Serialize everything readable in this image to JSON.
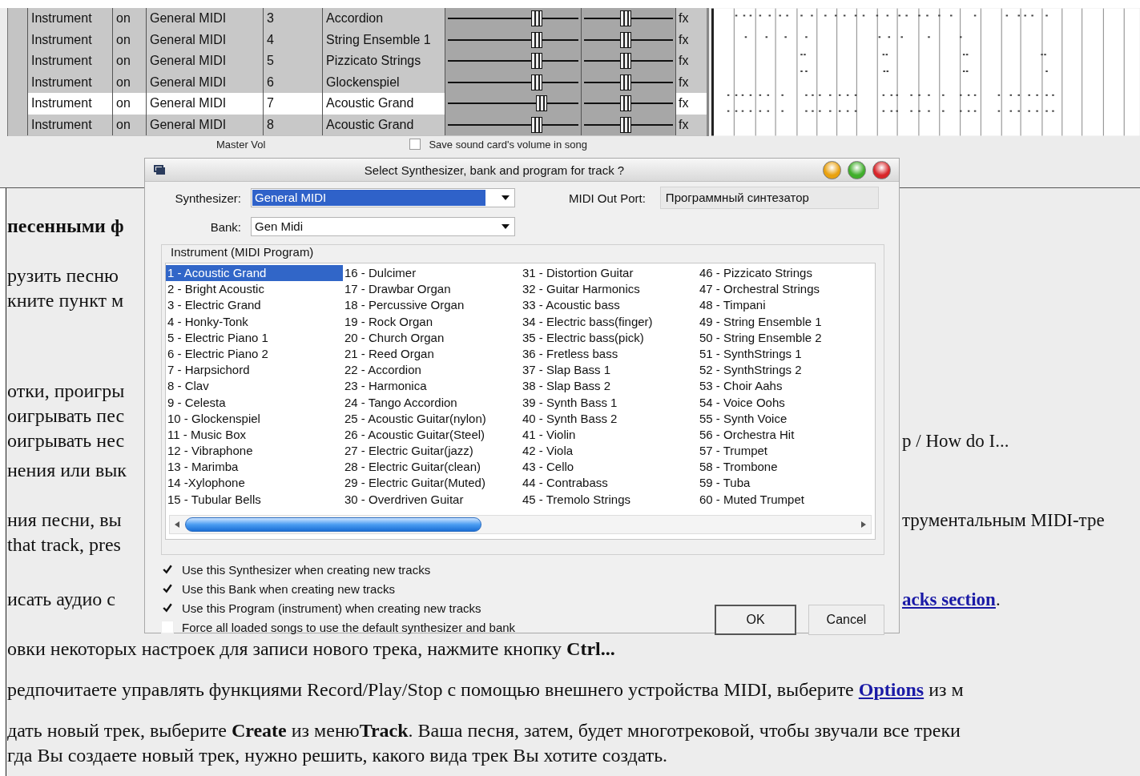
{
  "tracks": {
    "rows": [
      {
        "type": "Instrument",
        "state": "on",
        "synth": "General MIDI",
        "channel": "3",
        "program": "Accordion",
        "volume": {
          "level": 0.68
        },
        "pan": {
          "level": 0.47
        },
        "fx": "fx",
        "selected": false
      },
      {
        "type": "Instrument",
        "state": "on",
        "synth": "General MIDI",
        "channel": "4",
        "program": "String Ensemble 1",
        "volume": {
          "level": 0.68
        },
        "pan": {
          "level": 0.47
        },
        "fx": "fx",
        "selected": false
      },
      {
        "type": "Instrument",
        "state": "on",
        "synth": "General MIDI",
        "channel": "5",
        "program": "Pizzicato Strings",
        "volume": {
          "level": 0.68
        },
        "pan": {
          "level": 0.47
        },
        "fx": "fx",
        "selected": false
      },
      {
        "type": "Instrument",
        "state": "on",
        "synth": "General MIDI",
        "channel": "6",
        "program": "Glockenspiel",
        "volume": {
          "level": 0.68
        },
        "pan": {
          "level": 0.47
        },
        "fx": "fx",
        "selected": false
      },
      {
        "type": "Instrument",
        "state": "on",
        "synth": "General MIDI",
        "channel": "7",
        "program": "Acoustic Grand",
        "volume": {
          "level": 0.72
        },
        "pan": {
          "level": 0.47
        },
        "fx": "fx",
        "selected": true
      },
      {
        "type": "Instrument",
        "state": "on",
        "synth": "General MIDI",
        "channel": "8",
        "program": "Acoustic Grand",
        "volume": {
          "level": 0.68
        },
        "pan": {
          "level": 0.47
        },
        "fx": "fx",
        "selected": false
      }
    ]
  },
  "mixer": {
    "master_vol": "Master Vol",
    "save_volume": {
      "label": "Save sound card's volume in song",
      "checked": false
    }
  },
  "article": {
    "paragraphs": [
      {
        "lines": [
          {
            "kind": "split",
            "left": [
              {
                "kind": "text",
                "text": "**песенными ф**"
              }
            ]
          }
        ]
      },
      {
        "lines": [
          {
            "kind": "split",
            "left": [
              {
                "kind": "text",
                "text": "рузить песню"
              }
            ]
          },
          {
            "kind": "split",
            "left": [
              {
                "kind": "text",
                "text": "кните пункт м"
              }
            ]
          }
        ]
      },
      {
        "lines": [
          {
            "kind": "split",
            "left": [
              {
                "kind": "text",
                "text": "отки, проигры"
              }
            ]
          },
          {
            "kind": "split",
            "left": [
              {
                "kind": "text",
                "text": "оигрывать пес"
              }
            ]
          },
          {
            "kind": "split",
            "left": [
              {
                "kind": "text",
                "text": "оигрывать нес"
              }
            ],
            "right": [
              {
                "kind": "text",
                "text": "p / How do I..."
              }
            ]
          }
        ]
      },
      {
        "lines": [
          {
            "kind": "split",
            "left": [
              {
                "kind": "text",
                "text": "нения или вык"
              }
            ]
          }
        ]
      },
      {
        "lines": [
          {
            "kind": "split",
            "left": [
              {
                "kind": "text",
                "text": "ния песни, вы"
              }
            ],
            "right": [
              {
                "kind": "text",
                "text": "трументальным MIDI-тре"
              }
            ]
          },
          {
            "kind": "split",
            "left": [
              {
                "kind": "text",
                "text": "that track, pres"
              }
            ]
          }
        ]
      },
      {
        "lines": [
          {
            "kind": "split",
            "left": [
              {
                "kind": "text",
                "text": "исать аудио с"
              }
            ],
            "right": [
              {
                "kind": "link",
                "text": "acks section"
              },
              {
                "kind": "text",
                "text": "."
              }
            ]
          }
        ]
      },
      {
        "lines": [
          {
            "kind": "full",
            "left": [
              {
                "kind": "text",
                "text": "овки некоторых настроек для записи нового трека, нажмите кнопку **Ctrl...**"
              }
            ]
          }
        ]
      },
      {
        "lines": [
          {
            "kind": "full",
            "left": [
              {
                "kind": "text",
                "text": "редпочитаете управлять функциями Record/Play/Stop с помощью внешнего устройства MIDI, выберите"
              },
              {
                "kind": "link",
                "text": "Options"
              },
              {
                "kind": "text",
                "text": "из м"
              }
            ]
          }
        ]
      },
      {
        "lines": [
          {
            "kind": "full",
            "left": [
              {
                "kind": "text",
                "text": "дать новый трек, выберите **Create** из меню**Track**. Ваша песня, затем, будет многотрековой, чтобы звучали все треки"
              }
            ]
          },
          {
            "kind": "full",
            "left": [
              {
                "kind": "text",
                "text": "гда Вы создаете новый трек, нужно решить, какого вида трек Вы хотите создать."
              }
            ]
          }
        ]
      }
    ]
  },
  "dialog": {
    "title": "Select Synthesizer, bank and program for track ?",
    "synthesizer": {
      "label": "Synthesizer:",
      "value": "General MIDI"
    },
    "midi_out_port": {
      "label": "MIDI Out Port:",
      "value": "Программный синтезатор"
    },
    "bank": {
      "label": "Bank:",
      "value": "Gen Midi"
    },
    "instrument_group": {
      "title": "Instrument (MIDI Program)",
      "items": [
        {
          "label": "1 - Acoustic Grand",
          "selected": true
        },
        {
          "label": "2 - Bright Acoustic",
          "selected": false
        },
        {
          "label": "3 - Electric Grand",
          "selected": false
        },
        {
          "label": "4 - Honky-Tonk",
          "selected": false
        },
        {
          "label": "5 - Electric Piano 1",
          "selected": false
        },
        {
          "label": "6 - Electric Piano 2",
          "selected": false
        },
        {
          "label": "7 - Harpsichord",
          "selected": false
        },
        {
          "label": "8 - Clav",
          "selected": false
        },
        {
          "label": "9 - Celesta",
          "selected": false
        },
        {
          "label": "10 - Glockenspiel",
          "selected": false
        },
        {
          "label": "11 - Music Box",
          "selected": false
        },
        {
          "label": "12 - Vibraphone",
          "selected": false
        },
        {
          "label": "13 - Marimba",
          "selected": false
        },
        {
          "label": "14 -Xylophone",
          "selected": false
        },
        {
          "label": "15 - Tubular Bells",
          "selected": false
        },
        {
          "label": "16 - Dulcimer",
          "selected": false
        },
        {
          "label": "17 - Drawbar Organ",
          "selected": false
        },
        {
          "label": "18 - Percussive Organ",
          "selected": false
        },
        {
          "label": "19 - Rock Organ",
          "selected": false
        },
        {
          "label": "20 - Church Organ",
          "selected": false
        },
        {
          "label": "21 - Reed Organ",
          "selected": false
        },
        {
          "label": "22 - Accordion",
          "selected": false
        },
        {
          "label": "23 - Harmonica",
          "selected": false
        },
        {
          "label": "24 - Tango Accordion",
          "selected": false
        },
        {
          "label": "25 - Acoustic Guitar(nylon)",
          "selected": false
        },
        {
          "label": "26 - Acoustic Guitar(Steel)",
          "selected": false
        },
        {
          "label": "27 - Electric Guitar(jazz)",
          "selected": false
        },
        {
          "label": "28 - Electric Guitar(clean)",
          "selected": false
        },
        {
          "label": "29 - Electric Guitar(Muted)",
          "selected": false
        },
        {
          "label": "30 - Overdriven Guitar",
          "selected": false
        },
        {
          "label": "31 - Distortion Guitar",
          "selected": false
        },
        {
          "label": "32 - Guitar Harmonics",
          "selected": false
        },
        {
          "label": "33 - Acoustic bass",
          "selected": false
        },
        {
          "label": "34 - Electric bass(finger)",
          "selected": false
        },
        {
          "label": "35 - Electric bass(pick)",
          "selected": false
        },
        {
          "label": "36 - Fretless bass",
          "selected": false
        },
        {
          "label": "37 - Slap Bass 1",
          "selected": false
        },
        {
          "label": "38 - Slap Bass 2",
          "selected": false
        },
        {
          "label": "39 - Synth Bass 1",
          "selected": false
        },
        {
          "label": "40 - Synth Bass 2",
          "selected": false
        },
        {
          "label": "41 - Violin",
          "selected": false
        },
        {
          "label": "42 - Viola",
          "selected": false
        },
        {
          "label": "43 - Cello",
          "selected": false
        },
        {
          "label": "44 - Contrabass",
          "selected": false
        },
        {
          "label": "45 - Tremolo Strings",
          "selected": false
        },
        {
          "label": "46 - Pizzicato Strings",
          "selected": false
        },
        {
          "label": "47 - Orchestral Strings",
          "selected": false
        },
        {
          "label": "48 - Timpani",
          "selected": false
        },
        {
          "label": "49 - String Ensemble 1",
          "selected": false
        },
        {
          "label": "50 - String Ensemble 2",
          "selected": false
        },
        {
          "label": "51 - SynthStrings 1",
          "selected": false
        },
        {
          "label": "52 - SynthStrings 2",
          "selected": false
        },
        {
          "label": "53 - Choir Aahs",
          "selected": false
        },
        {
          "label": "54 - Voice Oohs",
          "selected": false
        },
        {
          "label": "55 - Synth Voice",
          "selected": false
        },
        {
          "label": "56 - Orchestra Hit",
          "selected": false
        },
        {
          "label": "57 - Trumpet",
          "selected": false
        },
        {
          "label": "58 - Trombone",
          "selected": false
        },
        {
          "label": "59 - Tuba",
          "selected": false
        },
        {
          "label": "60 - Muted Trumpet",
          "selected": false
        }
      ]
    },
    "options": [
      {
        "label": "Use this Synthesizer when creating new tracks",
        "checked": true
      },
      {
        "label": "Use this Bank when creating new tracks",
        "checked": true
      },
      {
        "label": "Use this Program (instrument) when creating new tracks",
        "checked": true
      },
      {
        "label": "Force all loaded songs to use the default synthesizer and bank",
        "checked": false
      }
    ],
    "buttons": [
      {
        "label": "OK",
        "default": true
      },
      {
        "label": "Cancel",
        "default": false
      }
    ]
  }
}
